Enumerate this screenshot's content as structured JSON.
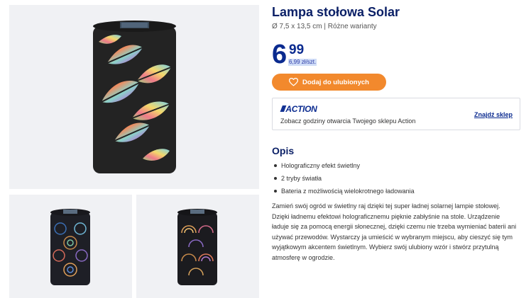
{
  "product": {
    "title": "Lampa stołowa Solar",
    "subtitle": "Ø 7,5 x 13,5 cm | Różne warianty"
  },
  "price": {
    "main": "6",
    "cents": "99",
    "unit_price": "6,99 zł/szt."
  },
  "favorite_button": {
    "label": "Dodaj do ulubionych",
    "icon": "heart-outline-icon"
  },
  "store_finder": {
    "logo": "ACTION",
    "text": "Zobacz godziny otwarcia Twojego sklepu Action",
    "link": "Znajdź sklep"
  },
  "description": {
    "heading": "Opis",
    "features": [
      "Holograficzny efekt świetlny",
      "2 tryby światła",
      "Bateria z możliwością wielokrotnego ładowania"
    ],
    "text": "Zamień swój ogród w świetlny raj dzięki tej super ładnej solarnej lampie stołowej. Dzięki ładnemu efektowi holograficznemu pięknie zabłyśnie na stole. Urządzenie ładuje się za pomocą energii słonecznej, dzięki czemu nie trzeba wymieniać baterii ani używać przewodów. Wystarczy ja umieścić w wybranym miejscu, aby cieszyć się tym wyjątkowym akcentem świetlnym. Wybierz swój ulubiony wzór i stwórz przytulną atmosferę w ogrodzie."
  },
  "colors": {
    "brand_navy": "#0a1f66",
    "button_orange": "#f2892d",
    "gallery_bg": "#f0f1f4",
    "lamp_body": "#232323",
    "unit_price_highlight": "#cfdcf7"
  }
}
